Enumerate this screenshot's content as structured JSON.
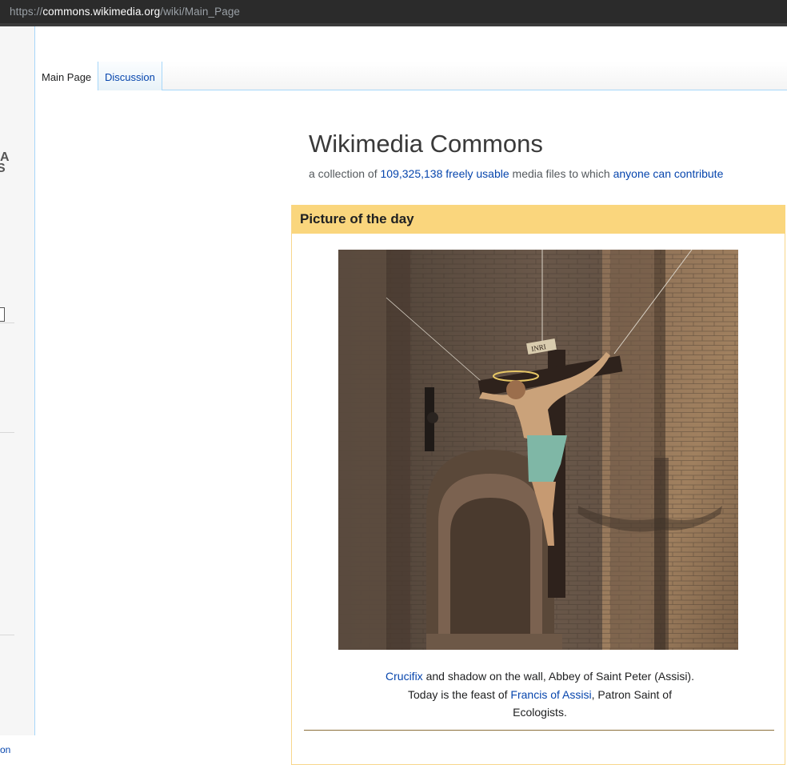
{
  "browser": {
    "url_scheme": "https://",
    "url_host": "commons.wikimedia.org",
    "url_path": "/wiki/Main_Page"
  },
  "sidebar": {
    "logo_fragment_1": "A",
    "logo_fragment_2": "S",
    "link_fragment": "on"
  },
  "tabs": [
    {
      "label": "Main Page",
      "selected": true
    },
    {
      "label": "Discussion",
      "selected": false
    }
  ],
  "page": {
    "title": "Wikimedia Commons",
    "subtitle_prefix": "a collection of ",
    "file_count_link": "109,325,138",
    "freely_usable_link": "freely usable",
    "subtitle_middle": " media files to which ",
    "contribute_link": "anyone can contribute"
  },
  "potd": {
    "heading": "Picture of the day",
    "caption_link_1": "Crucifix",
    "caption_text_1": " and shadow on the wall, Abbey of Saint Peter (Assisi).",
    "caption_text_2": "Today is the feast of ",
    "caption_link_2": "Francis of Assisi",
    "caption_text_3": ", Patron Saint of",
    "caption_text_4": "Ecologists.",
    "sign_text": "INRI"
  },
  "colors": {
    "link": "#0645ad",
    "potd_header_bg": "#fad67d",
    "potd_border": "#f8d68b",
    "tab_border": "#a7d7f9"
  }
}
